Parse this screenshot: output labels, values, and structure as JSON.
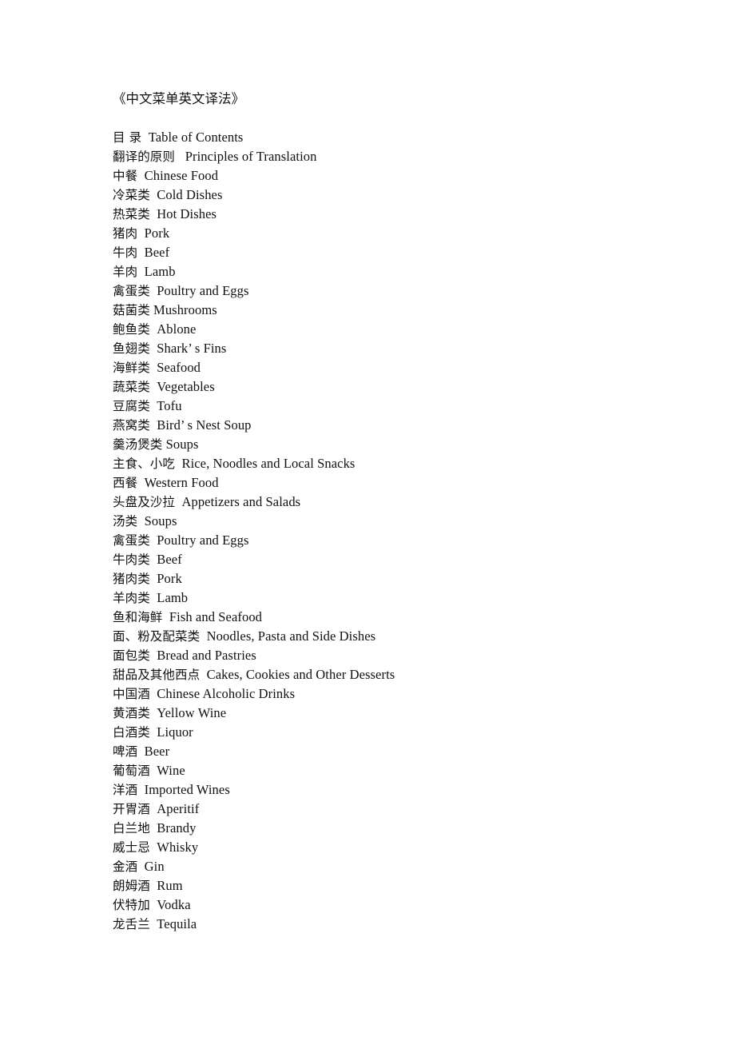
{
  "document": {
    "title": "《中文菜单英文译法》",
    "title_zh": "中文菜单英文译法"
  },
  "toc": {
    "entries": [
      {
        "zh": "目 录",
        "gap": "  ",
        "en": "Table of Contents"
      },
      {
        "zh": "翻译的原则",
        "gap": "   ",
        "en": "Principles of Translation"
      },
      {
        "zh": "中餐",
        "gap": "  ",
        "en": "Chinese Food"
      },
      {
        "zh": "冷菜类",
        "gap": "  ",
        "en": "Cold Dishes"
      },
      {
        "zh": "热菜类",
        "gap": "  ",
        "en": "Hot Dishes"
      },
      {
        "zh": "猪肉",
        "gap": "  ",
        "en": "Pork"
      },
      {
        "zh": "牛肉",
        "gap": "  ",
        "en": "Beef"
      },
      {
        "zh": "羊肉",
        "gap": "  ",
        "en": "Lamb"
      },
      {
        "zh": "禽蛋类",
        "gap": "  ",
        "en": "Poultry and Eggs"
      },
      {
        "zh": "菇菌类",
        "gap": " ",
        "en": "Mushrooms"
      },
      {
        "zh": "鲍鱼类",
        "gap": "  ",
        "en": "Ablone"
      },
      {
        "zh": "鱼翅类",
        "gap": "  ",
        "en": "Shark’ s Fins"
      },
      {
        "zh": "海鲜类",
        "gap": "  ",
        "en": "Seafood"
      },
      {
        "zh": "蔬菜类",
        "gap": "  ",
        "en": "Vegetables"
      },
      {
        "zh": "豆腐类",
        "gap": "  ",
        "en": "Tofu"
      },
      {
        "zh": "燕窝类",
        "gap": "  ",
        "en": "Bird’ s Nest Soup"
      },
      {
        "zh": "羹汤煲类",
        "gap": " ",
        "en": "Soups"
      },
      {
        "zh": "主食、小吃",
        "gap": "  ",
        "en": "Rice, Noodles and Local Snacks"
      },
      {
        "zh": "西餐",
        "gap": "  ",
        "en": "Western Food"
      },
      {
        "zh": "头盘及沙拉",
        "gap": "  ",
        "en": "Appetizers and Salads"
      },
      {
        "zh": "汤类",
        "gap": "  ",
        "en": "Soups"
      },
      {
        "zh": "禽蛋类",
        "gap": "  ",
        "en": "Poultry and Eggs"
      },
      {
        "zh": "牛肉类",
        "gap": "  ",
        "en": "Beef"
      },
      {
        "zh": "猪肉类",
        "gap": "  ",
        "en": "Pork"
      },
      {
        "zh": "羊肉类",
        "gap": "  ",
        "en": "Lamb"
      },
      {
        "zh": "鱼和海鲜",
        "gap": "  ",
        "en": "Fish and Seafood"
      },
      {
        "zh": "面、粉及配菜类",
        "gap": "  ",
        "en": "Noodles, Pasta and Side Dishes"
      },
      {
        "zh": "面包类",
        "gap": "  ",
        "en": "Bread and Pastries"
      },
      {
        "zh": "甜品及其他西点",
        "gap": "  ",
        "en": "Cakes, Cookies and Other Desserts"
      },
      {
        "zh": "中国酒",
        "gap": "  ",
        "en": "Chinese Alcoholic Drinks"
      },
      {
        "zh": "黄酒类",
        "gap": "  ",
        "en": "Yellow Wine"
      },
      {
        "zh": "白酒类",
        "gap": "  ",
        "en": "Liquor"
      },
      {
        "zh": "啤酒",
        "gap": "  ",
        "en": "Beer"
      },
      {
        "zh": "葡萄酒",
        "gap": "  ",
        "en": "Wine"
      },
      {
        "zh": "洋酒",
        "gap": "  ",
        "en": "Imported Wines"
      },
      {
        "zh": "开胃酒",
        "gap": "  ",
        "en": "Aperitif"
      },
      {
        "zh": "白兰地",
        "gap": "  ",
        "en": "Brandy"
      },
      {
        "zh": "威士忌",
        "gap": "  ",
        "en": "Whisky"
      },
      {
        "zh": "金酒",
        "gap": "  ",
        "en": "Gin"
      },
      {
        "zh": "朗姆酒",
        "gap": "  ",
        "en": "Rum"
      },
      {
        "zh": "伏特加",
        "gap": "  ",
        "en": "Vodka"
      },
      {
        "zh": "龙舌兰",
        "gap": "  ",
        "en": "Tequila"
      }
    ]
  },
  "colors": {
    "page_background": "#ffffff",
    "text": "#111111"
  }
}
